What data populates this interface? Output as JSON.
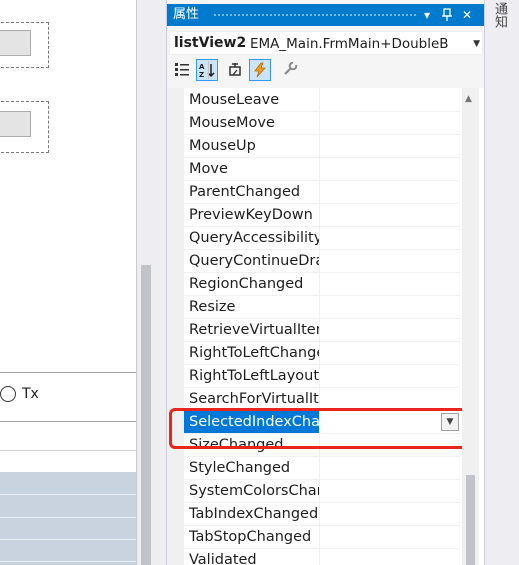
{
  "designer": {
    "radio_label": "Tx"
  },
  "panel": {
    "title": "属性",
    "title_buttons": [
      "▾",
      "ᅟ",
      "✕"
    ],
    "object_name": "listView2",
    "object_type": "EMA_Main.FrmMain+DoubleB",
    "toolbar_icons": [
      "categorized-icon",
      "alphabetical-icon",
      "properties-icon",
      "events-icon",
      "property-pages-icon"
    ],
    "properties": [
      "MouseLeave",
      "MouseMove",
      "MouseUp",
      "Move",
      "ParentChanged",
      "PreviewKeyDown",
      "QueryAccessibilityHelp",
      "QueryContinueDrag",
      "RegionChanged",
      "Resize",
      "RetrieveVirtualItem",
      "RightToLeftChanged",
      "RightToLeftLayoutChanged",
      "SearchForVirtualItem",
      "SelectedIndexChanged",
      "SizeChanged",
      "StyleChanged",
      "SystemColorsChanged",
      "TabIndexChanged",
      "TabStopChanged",
      "Validated"
    ],
    "selected_index": 14
  },
  "right_tab": {
    "label": "通知"
  },
  "colors": {
    "accent": "#007acc",
    "selection": "#0078d7",
    "highlight_box": "#e8261e"
  }
}
